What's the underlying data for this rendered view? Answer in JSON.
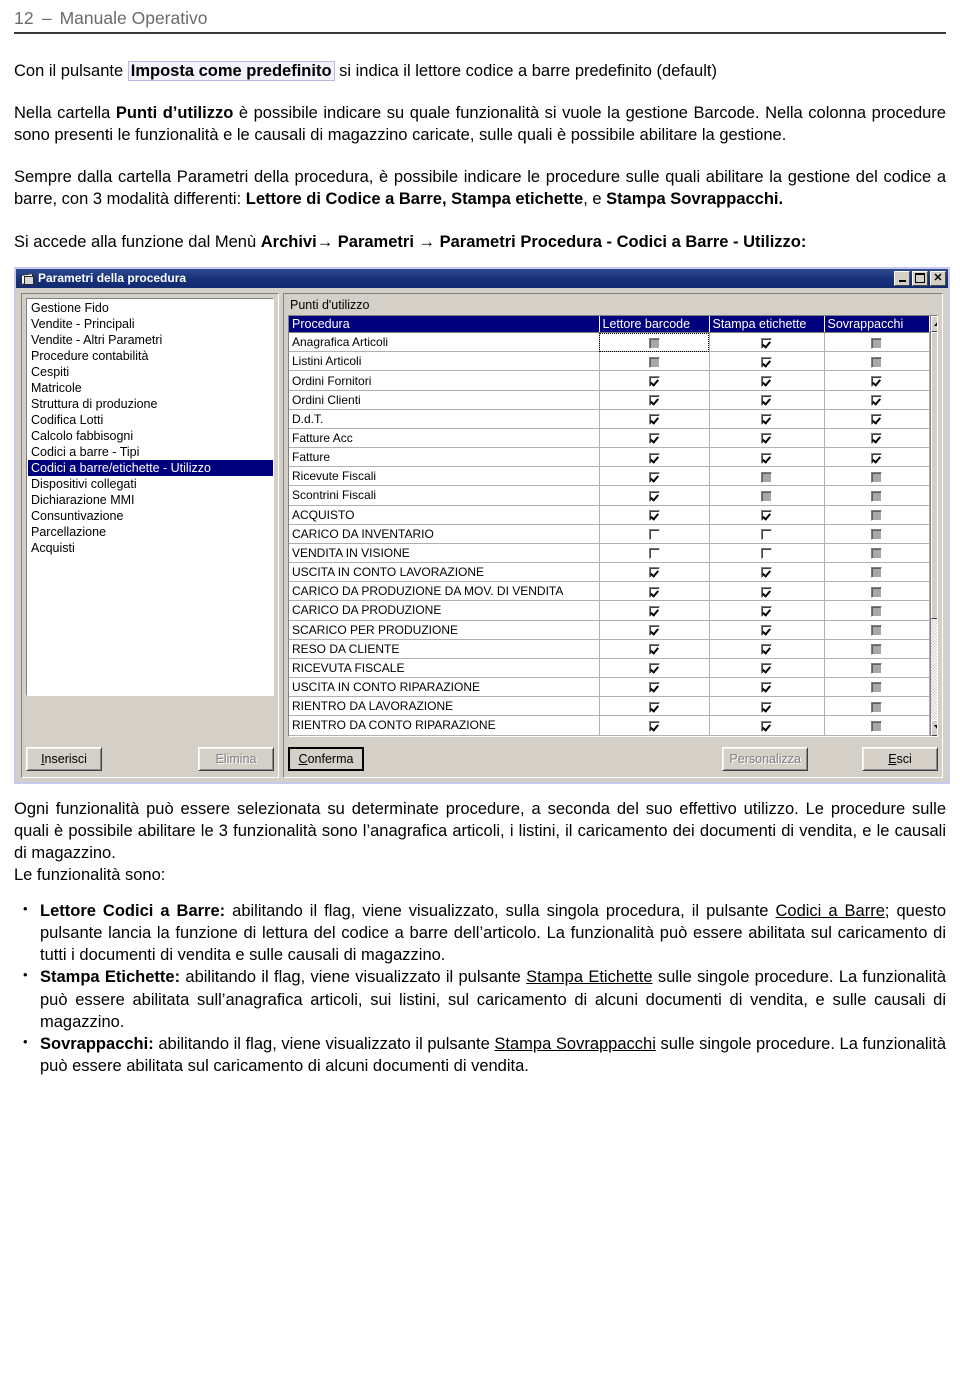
{
  "header": {
    "page_number": "12",
    "dash": "–",
    "title": "Manuale Operativo"
  },
  "paragraphs": {
    "p1_a": "Con il pulsante ",
    "p1_boxed": "Imposta come predefinito",
    "p1_b": " si indica il lettore codice a barre predefinito (default)",
    "p2_a": "Nella cartella ",
    "p2_bold": "Punti d’utilizzo",
    "p2_b": " è possibile indicare su quale funzionalità si vuole la gestione Barcode. Nella colonna procedure sono presenti le funzionalità e le causali di magazzino caricate, sulle quali è possibile abilitare la gestione.",
    "p3_a": "Sempre dalla cartella Parametri della procedura, è possibile indicare le procedure sulle quali abilitare la gestione del codice a barre, con 3 modalità differenti: ",
    "p3_b1": "Lettore di Codice a Barre, Stampa etichette",
    "p3_mid": ", e ",
    "p3_b2": "Stampa Sovrappacchi.",
    "p4_a": "Si accede alla funzione dal Menù ",
    "p4_b1": "Archivi",
    "p4_arrow1": "→",
    "p4_b2": "Parametri",
    "p4_arrow2": "→",
    "p4_b3": "Parametri Procedura - Codici a Barre - Utilizzo:",
    "p5": "Ogni funzionalità può essere selezionata su determinate procedure, a seconda del suo effettivo utilizzo. Le procedure sulle quali è possibile abilitare le 3 funzionalità sono l’anagrafica articoli, i listini, il caricamento dei documenti di vendita, e le causali di magazzino.",
    "p6": "Le funzionalità sono:"
  },
  "features": [
    {
      "title": "Lettore Codici a Barre:",
      "text_a": " abilitando il flag, viene visualizzato, sulla singola procedura, il pulsante ",
      "link": "Codici a Barre",
      "text_b": "; questo pulsante lancia la funzione di lettura del codice a barre dell’articolo. La funzionalità può essere abilitata sul caricamento di tutti i documenti di vendita e sulle causali di magazzino."
    },
    {
      "title": "Stampa Etichette:",
      "text_a": " abilitando il flag, viene visualizzato il pulsante ",
      "link": "Stampa Etichette",
      "text_b": " sulle singole procedure. La funzionalità può essere abilitata sull’anagrafica articoli, sui listini, sul caricamento di alcuni documenti di vendita, e sulle causali di magazzino."
    },
    {
      "title": "Sovrappacchi:",
      "text_a": " abilitando il flag, viene visualizzato il pulsante ",
      "link": "Stampa Sovrappacchi",
      "text_b": " sulle singole procedure. La funzionalità può essere abilitata sul caricamento di alcuni  documenti di vendita."
    }
  ],
  "screenshot": {
    "window_title": "Parametri della procedura",
    "window_icon": "window-document-icon",
    "controls": {
      "minimize": "minimize-icon",
      "maximize": "maximize-icon",
      "close": "close-icon"
    },
    "left_list": {
      "items": [
        "Gestione Fido",
        "Vendite - Principali",
        "Vendite - Altri Parametri",
        "Procedure contabilità",
        "Cespiti",
        "Matricole",
        "Struttura di produzione",
        "Codifica Lotti",
        "Calcolo fabbisogni",
        "Codici a barre - Tipi",
        "Codici a barre/etichette - Utilizzo",
        "Dispositivi collegati",
        "Dichiarazione MMI",
        "Consuntivazione",
        "Parcellazione",
        "Acquisti"
      ],
      "selected_index": 10
    },
    "left_buttons": [
      {
        "label": "Inserisci",
        "accel": "I",
        "disabled": false
      },
      {
        "label": "Elimina",
        "accel": "m",
        "disabled": true
      }
    ],
    "right_panel": {
      "caption": "Punti d'utilizzo",
      "columns": [
        "Procedura",
        "Lettore barcode",
        "Stampa etichette",
        "Sovrappacchi"
      ],
      "rows": [
        {
          "name": "Anagrafica Articoli",
          "lettore": "disabled",
          "stampa": "checked",
          "sovra": "disabled",
          "focus": true
        },
        {
          "name": "Listini Articoli",
          "lettore": "disabled",
          "stampa": "checked",
          "sovra": "disabled"
        },
        {
          "name": "Ordini Fornitori",
          "lettore": "checked",
          "stampa": "checked",
          "sovra": "checked"
        },
        {
          "name": "Ordini Clienti",
          "lettore": "checked",
          "stampa": "checked",
          "sovra": "checked"
        },
        {
          "name": "D.d.T.",
          "lettore": "checked",
          "stampa": "checked",
          "sovra": "checked"
        },
        {
          "name": "Fatture Acc",
          "lettore": "checked",
          "stampa": "checked",
          "sovra": "checked"
        },
        {
          "name": "Fatture",
          "lettore": "checked",
          "stampa": "checked",
          "sovra": "checked"
        },
        {
          "name": "Ricevute Fiscali",
          "lettore": "checked",
          "stampa": "disabled",
          "sovra": "disabled"
        },
        {
          "name": "Scontrini Fiscali",
          "lettore": "checked",
          "stampa": "disabled",
          "sovra": "disabled"
        },
        {
          "name": "ACQUISTO",
          "lettore": "checked",
          "stampa": "checked",
          "sovra": "disabled"
        },
        {
          "name": "CARICO DA INVENTARIO",
          "lettore": "unchecked",
          "stampa": "unchecked",
          "sovra": "disabled"
        },
        {
          "name": "VENDITA IN VISIONE",
          "lettore": "unchecked",
          "stampa": "unchecked",
          "sovra": "disabled"
        },
        {
          "name": "USCITA IN CONTO LAVORAZIONE",
          "lettore": "checked",
          "stampa": "checked",
          "sovra": "disabled"
        },
        {
          "name": "CARICO DA PRODUZIONE DA MOV. DI VENDITA",
          "lettore": "checked",
          "stampa": "checked",
          "sovra": "disabled"
        },
        {
          "name": "CARICO DA PRODUZIONE",
          "lettore": "checked",
          "stampa": "checked",
          "sovra": "disabled"
        },
        {
          "name": "SCARICO PER PRODUZIONE",
          "lettore": "checked",
          "stampa": "checked",
          "sovra": "disabled"
        },
        {
          "name": "RESO DA CLIENTE",
          "lettore": "checked",
          "stampa": "checked",
          "sovra": "disabled"
        },
        {
          "name": "RICEVUTA FISCALE",
          "lettore": "checked",
          "stampa": "checked",
          "sovra": "disabled"
        },
        {
          "name": "USCITA IN CONTO RIPARAZIONE",
          "lettore": "checked",
          "stampa": "checked",
          "sovra": "disabled"
        },
        {
          "name": "RIENTRO DA LAVORAZIONE",
          "lettore": "checked",
          "stampa": "checked",
          "sovra": "disabled"
        },
        {
          "name": "RIENTRO DA CONTO RIPARAZIONE",
          "lettore": "checked",
          "stampa": "checked",
          "sovra": "disabled"
        }
      ]
    },
    "right_buttons": [
      {
        "label": "Conferma",
        "accel": "C",
        "disabled": false,
        "default": true
      },
      {
        "label": "Personalizza",
        "accel": "P",
        "disabled": true,
        "default": false
      },
      {
        "label": "Esci",
        "accel": "E",
        "disabled": false,
        "default": false
      }
    ]
  },
  "colors": {
    "title_bar": "#17307a",
    "selection": "#00007e",
    "window_face": "#d4d0c8",
    "window_outer_border": "#c7c9ee",
    "box_highlight": "#b8b8e0"
  }
}
